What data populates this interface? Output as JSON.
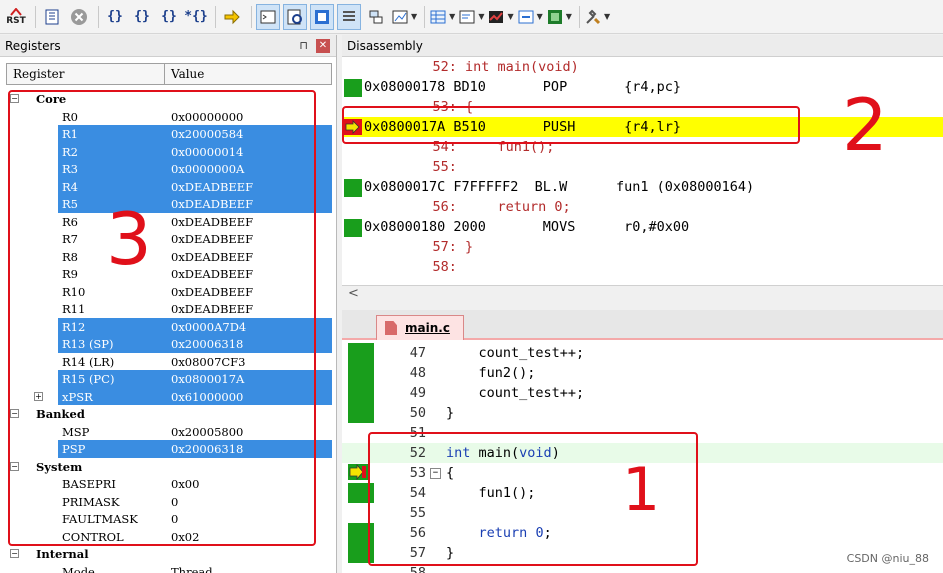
{
  "toolbar": {
    "rst_label": "RST",
    "buttons": [
      "reset-icon",
      "step-icon",
      "stop-icon",
      "step-into-icon",
      "step-over-icon",
      "step-out-icon",
      "run-to-cursor-icon",
      "show-next-icon",
      "command-window-icon",
      "disassembly-window-icon",
      "symbols-window-icon",
      "registers-window-icon",
      "call-stack-icon",
      "watch-window-icon",
      "memory-window-icon",
      "serial-window-icon",
      "analysis-window-icon",
      "trace-icon",
      "system-viewer-icon",
      "toolbox-icon"
    ]
  },
  "registers": {
    "title": "Registers",
    "pin": "⊓",
    "close": "✕",
    "col_register": "Register",
    "col_value": "Value",
    "rows": [
      {
        "name": "Core",
        "value": "",
        "level": 0,
        "group": true,
        "expanded": true,
        "sel": false
      },
      {
        "name": "R0",
        "value": "0x00000000",
        "level": 1,
        "sel": false
      },
      {
        "name": "R1",
        "value": "0x20000584",
        "level": 1,
        "sel": true
      },
      {
        "name": "R2",
        "value": "0x00000014",
        "level": 1,
        "sel": true
      },
      {
        "name": "R3",
        "value": "0x0000000A",
        "level": 1,
        "sel": true
      },
      {
        "name": "R4",
        "value": "0xDEADBEEF",
        "level": 1,
        "sel": true
      },
      {
        "name": "R5",
        "value": "0xDEADBEEF",
        "level": 1,
        "sel": true
      },
      {
        "name": "R6",
        "value": "0xDEADBEEF",
        "level": 1,
        "sel": false
      },
      {
        "name": "R7",
        "value": "0xDEADBEEF",
        "level": 1,
        "sel": false
      },
      {
        "name": "R8",
        "value": "0xDEADBEEF",
        "level": 1,
        "sel": false
      },
      {
        "name": "R9",
        "value": "0xDEADBEEF",
        "level": 1,
        "sel": false
      },
      {
        "name": "R10",
        "value": "0xDEADBEEF",
        "level": 1,
        "sel": false
      },
      {
        "name": "R11",
        "value": "0xDEADBEEF",
        "level": 1,
        "sel": false
      },
      {
        "name": "R12",
        "value": "0x0000A7D4",
        "level": 1,
        "sel": true
      },
      {
        "name": "R13 (SP)",
        "value": "0x20006318",
        "level": 1,
        "sel": true
      },
      {
        "name": "R14 (LR)",
        "value": "0x08007CF3",
        "level": 1,
        "sel": false
      },
      {
        "name": "R15 (PC)",
        "value": "0x0800017A",
        "level": 1,
        "sel": true
      },
      {
        "name": "xPSR",
        "value": "0x61000000",
        "level": 1,
        "sel": true,
        "expandable": true
      },
      {
        "name": "Banked",
        "value": "",
        "level": 0,
        "group": true,
        "expanded": true,
        "sel": false
      },
      {
        "name": "MSP",
        "value": "0x20005800",
        "level": 1,
        "sel": false
      },
      {
        "name": "PSP",
        "value": "0x20006318",
        "level": 1,
        "sel": true
      },
      {
        "name": "System",
        "value": "",
        "level": 0,
        "group": true,
        "expanded": true,
        "sel": false
      },
      {
        "name": "BASEPRI",
        "value": "0x00",
        "level": 1,
        "sel": false
      },
      {
        "name": "PRIMASK",
        "value": "0",
        "level": 1,
        "sel": false
      },
      {
        "name": "FAULTMASK",
        "value": "0",
        "level": 1,
        "sel": false
      },
      {
        "name": "CONTROL",
        "value": "0x02",
        "level": 1,
        "sel": false
      },
      {
        "name": "Internal",
        "value": "",
        "level": 0,
        "group": true,
        "expanded": true,
        "sel": false
      },
      {
        "name": "Mode",
        "value": "Thread",
        "level": 1,
        "sel": false
      }
    ]
  },
  "disassembly": {
    "title": "Disassembly",
    "lines": [
      {
        "kind": "src",
        "text": "    52: int main(void)",
        "gutter": ""
      },
      {
        "kind": "asm",
        "text": "0x08000178 BD10       POP       {r4,pc}",
        "gutter": "green"
      },
      {
        "kind": "src",
        "text": "    53: {",
        "gutter": ""
      },
      {
        "kind": "asm",
        "text": "0x0800017A B510       PUSH      {r4,lr}",
        "gutter": "arrow",
        "current": true
      },
      {
        "kind": "src",
        "text": "    54:     fun1();",
        "gutter": ""
      },
      {
        "kind": "src",
        "text": "    55: ",
        "gutter": ""
      },
      {
        "kind": "asm",
        "text": "0x0800017C F7FFFFF2  BL.W      fun1 (0x08000164)",
        "gutter": "green"
      },
      {
        "kind": "src",
        "text": "    56:     return 0;",
        "gutter": ""
      },
      {
        "kind": "asm",
        "text": "0x08000180 2000       MOVS      r0,#0x00",
        "gutter": "green"
      },
      {
        "kind": "src",
        "text": "    57: }",
        "gutter": ""
      },
      {
        "kind": "src",
        "text": "    58: ",
        "gutter": ""
      }
    ],
    "scroll_left": "<"
  },
  "editor": {
    "tab_label": "main.c",
    "lines": [
      {
        "num": "47",
        "code": "    count_test++;",
        "green": true
      },
      {
        "num": "48",
        "code": "    fun2();",
        "green": true
      },
      {
        "num": "49",
        "code": "    count_test++;",
        "green": true
      },
      {
        "num": "50",
        "code": "}",
        "green": true
      },
      {
        "num": "51",
        "code": "",
        "green": false
      },
      {
        "num": "52",
        "code": "int main(void)",
        "green": false,
        "highlight": true
      },
      {
        "num": "53",
        "code": "{",
        "green": false,
        "arrow": true,
        "fold": true
      },
      {
        "num": "54",
        "code": "    fun1();",
        "green": true
      },
      {
        "num": "55",
        "code": "",
        "green": false
      },
      {
        "num": "56",
        "code": "    return 0;",
        "green": true
      },
      {
        "num": "57",
        "code": "}",
        "green": true
      },
      {
        "num": "58",
        "code": "",
        "green": false
      }
    ]
  },
  "annotations": {
    "one": "1",
    "two": "2",
    "three": "3",
    "color": "#e0101a"
  },
  "watermark": "CSDN @niu_88",
  "colors": {
    "selection": "#3a8de1",
    "current_line": "#ffff00",
    "coverage": "#199e1c",
    "keyword": "#1a3fb3",
    "source_addr": "#b22b2b"
  }
}
